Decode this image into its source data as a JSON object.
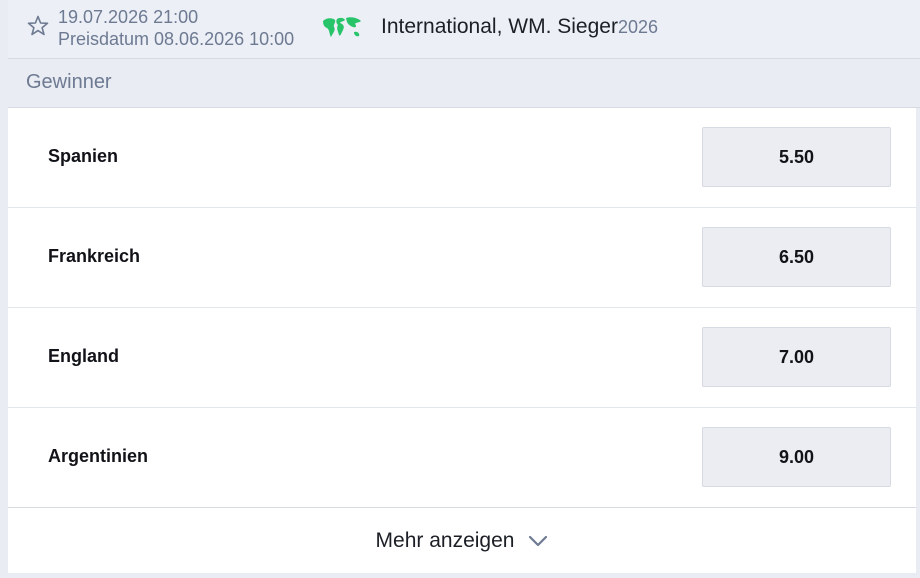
{
  "header": {
    "date_time": "19.07.2026 21:00",
    "price_date": "Preisdatum 08.06.2026 10:00",
    "event_name": "International, WM. Sieger",
    "event_year": "2026",
    "icons": {
      "favorite": "star-icon",
      "region": "globe-icon"
    }
  },
  "market": {
    "title": "Gewinner"
  },
  "selections": [
    {
      "name": "Spanien",
      "odds": "5.50"
    },
    {
      "name": "Frankreich",
      "odds": "6.50"
    },
    {
      "name": "England",
      "odds": "7.00"
    },
    {
      "name": "Argentinien",
      "odds": "9.00"
    }
  ],
  "show_more": {
    "label": "Mehr anzeigen",
    "icon": "chevron-down-icon"
  },
  "colors": {
    "background": "#e9ecf3",
    "muted_text": "#6d7a92",
    "odds_button": "#ebedf2",
    "globe_green": "#27c46a"
  }
}
